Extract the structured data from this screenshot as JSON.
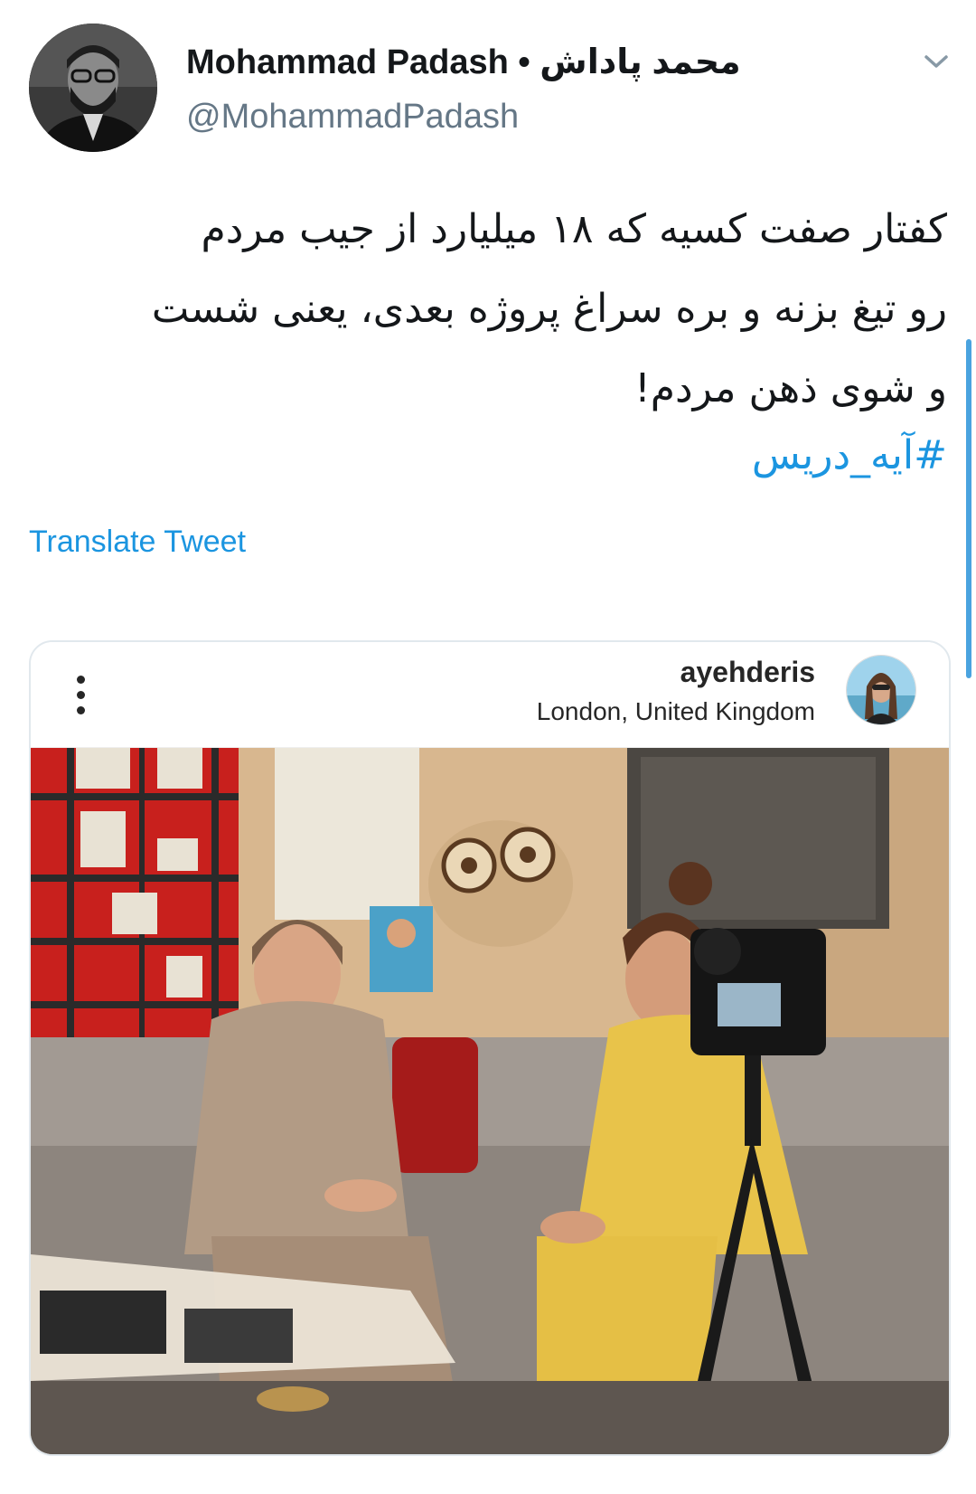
{
  "header": {
    "display_name": "Mohammad Padash • محمد پاداش",
    "handle": "@MohammadPadash"
  },
  "tweet": {
    "line1": "کفتار صفت کسیه که ۱۸ میلیارد از جیب مردم",
    "line2": "رو تیغ بزنه و بره سراغ پروژه بعدی، یعنی شست",
    "line3": "و شوی ذهن مردم!",
    "hashtag": "#آیه_دریس",
    "translate_label": "Translate Tweet"
  },
  "embed": {
    "username": "ayehderis",
    "location": "London, United Kingdom"
  },
  "icons": {
    "chevron": "chevron-down-icon",
    "more": "more-vertical-icon"
  },
  "colors": {
    "link": "#1b95e0",
    "handle": "#657786",
    "text": "#14171a"
  }
}
